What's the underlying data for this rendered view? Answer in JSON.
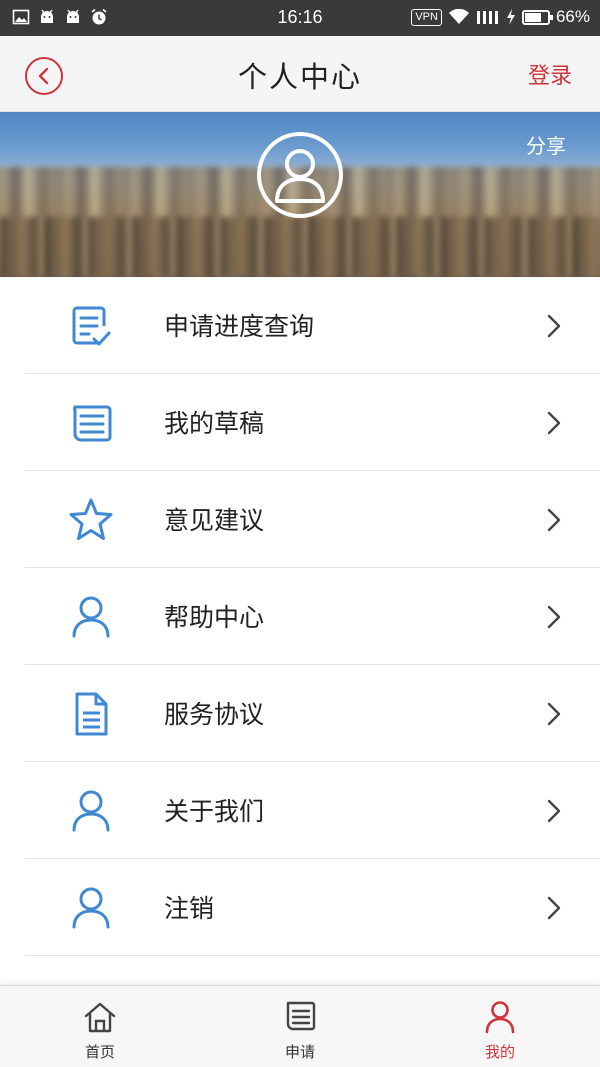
{
  "status_bar": {
    "time": "16:16",
    "vpn": "VPN",
    "battery": "66%",
    "battery_level": 0.66,
    "icons": [
      "gallery-icon",
      "android-icon",
      "android-icon",
      "alarm-icon",
      "wifi-icon",
      "signal-icon",
      "charging-icon",
      "battery-icon"
    ]
  },
  "header": {
    "title": "个人中心",
    "back_icon": "chevron-left-icon",
    "login_label": "登录",
    "accent_color": "#d0343a"
  },
  "banner": {
    "share_label": "分享",
    "avatar_icon": "user-avatar-icon"
  },
  "menu": {
    "icon_color": "#3f88d2",
    "items": [
      {
        "label": "申请进度查询",
        "icon": "application-progress-icon"
      },
      {
        "label": "我的草稿",
        "icon": "draft-icon"
      },
      {
        "label": "意见建议",
        "icon": "star-icon"
      },
      {
        "label": "帮助中心",
        "icon": "user-icon"
      },
      {
        "label": "服务协议",
        "icon": "document-icon"
      },
      {
        "label": "关于我们",
        "icon": "user-icon"
      },
      {
        "label": "注销",
        "icon": "user-icon"
      }
    ]
  },
  "tabs": [
    {
      "label": "首页",
      "icon": "home-icon",
      "active": false
    },
    {
      "label": "申请",
      "icon": "form-icon",
      "active": false
    },
    {
      "label": "我的",
      "icon": "user-icon",
      "active": true
    }
  ]
}
